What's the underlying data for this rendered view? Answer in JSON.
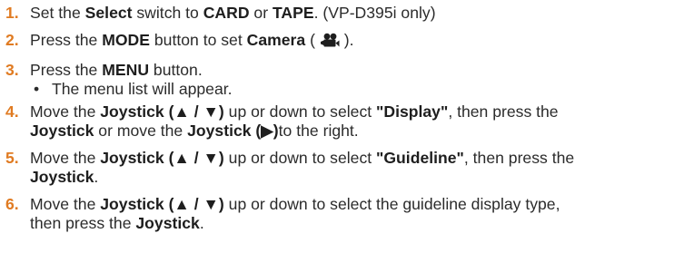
{
  "steps": [
    {
      "num": "1.",
      "t1": "Set the ",
      "b1": "Select",
      "t2": " switch to ",
      "b2": "CARD",
      "t3": " or ",
      "b3": "TAPE",
      "t4": ". (VP-D395i only)"
    },
    {
      "num": "2.",
      "t1": "Press the ",
      "b1": "MODE",
      "t2": " button to set ",
      "b2": "Camera",
      "t3": " ( ",
      "icon": "camera-mode-icon",
      "t4": " )."
    },
    {
      "num": "3.",
      "t1": "Press the ",
      "b1": "MENU",
      "t2": " button.",
      "bullet": "•",
      "sub": "The menu list will appear."
    },
    {
      "num": "4.",
      "t1": "Move the ",
      "b1": "Joystick (▲ / ▼)",
      "t2": " up or down to select ",
      "b2": "\"Display\"",
      "t3": ", then press the",
      "b3": "Joystick",
      "t4": " or move the ",
      "b4": "Joystick (▶)",
      "t5": "to the right."
    },
    {
      "num": "5.",
      "t1": "Move the ",
      "b1": "Joystick (▲ / ▼)",
      "t2": " up or down to select ",
      "b2": "\"Guideline\"",
      "t3": ", then press the",
      "b3": "Joystick",
      "t4": "."
    },
    {
      "num": "6.",
      "t1": "Move the ",
      "b1": "Joystick (▲ / ▼)",
      "t2": " up or down to select the guideline display type,",
      "t3": "then press the ",
      "b2": "Joystick",
      "t4": "."
    }
  ]
}
